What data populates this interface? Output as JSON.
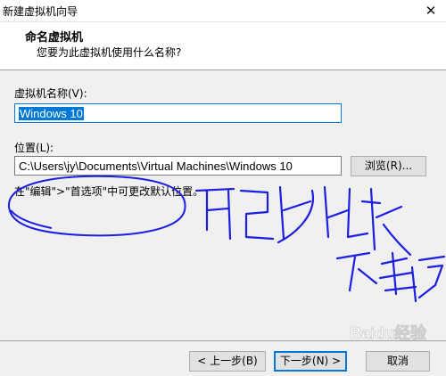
{
  "window": {
    "title": "新建虚拟机向导",
    "close_glyph": "✕"
  },
  "header": {
    "title": "命名虚拟机",
    "subtitle": "您要为此虚拟机使用什么名称?"
  },
  "vm_name": {
    "label": "虚拟机名称(V):",
    "value": "Windows 10"
  },
  "location": {
    "label": "位置(L):",
    "value": "C:\\Users\\jy\\Documents\\Virtual Machines\\Windows 10",
    "browse_label": "浏览(R)...",
    "hint": "在\"编辑\">\"首选项\"中可更改默认位置。"
  },
  "footer": {
    "back_label": "< 上一步(B)",
    "next_label": "下一步(N) >",
    "cancel_label": "取消"
  },
  "annotation": {
    "line1": "更改比较",
    "line2": "不方便",
    "ink_color": "#1c1ee0"
  },
  "watermark": {
    "text": "Baidu经验"
  }
}
